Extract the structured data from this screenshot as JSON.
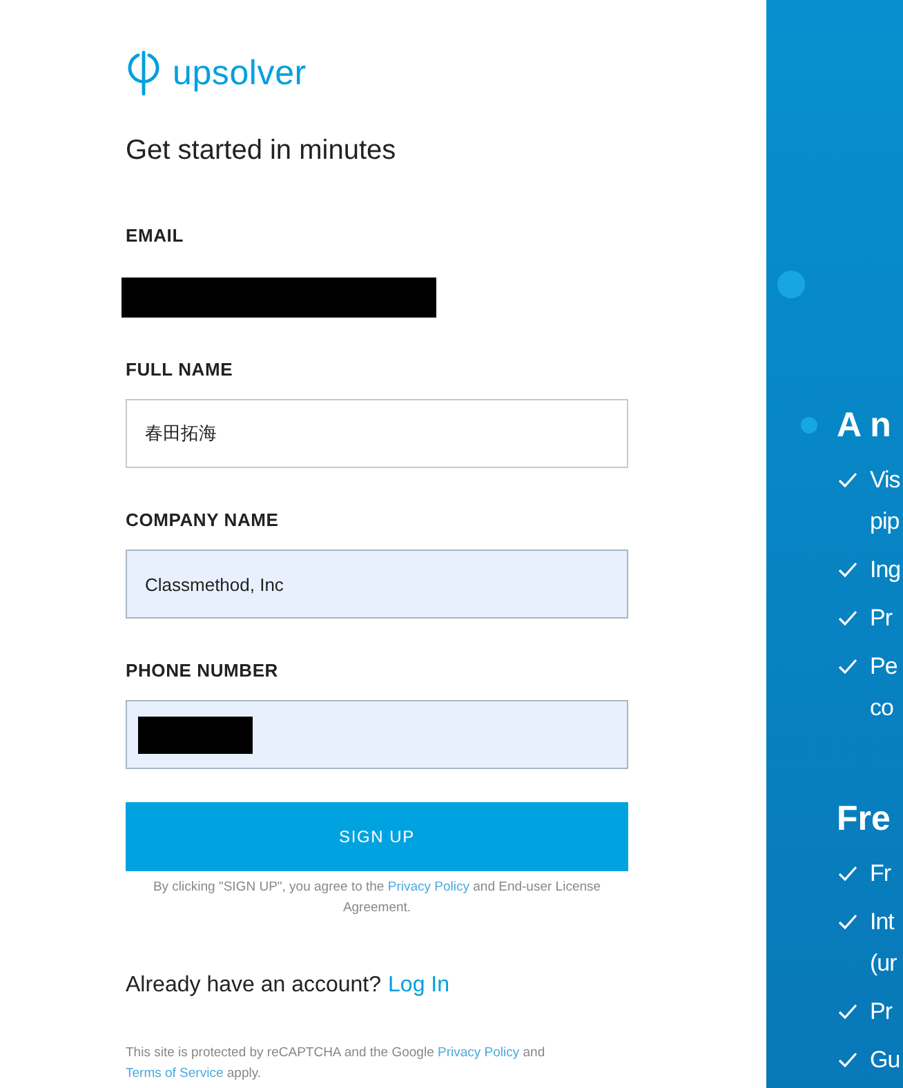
{
  "logo": {
    "text": "upsolver"
  },
  "heading": "Get started in minutes",
  "fields": [
    {
      "label": "EMAIL",
      "kind": "redacted",
      "autofilled": false
    },
    {
      "label": "FULL NAME",
      "kind": "text",
      "value": "春田拓海",
      "autofilled": false
    },
    {
      "label": "COMPANY NAME",
      "kind": "text",
      "value": "Classmethod, Inc",
      "autofilled": true
    },
    {
      "label": "PHONE NUMBER",
      "kind": "redacted-field",
      "autofilled": true
    }
  ],
  "submit": "SIGN UP",
  "agreement": {
    "before": "By clicking \"SIGN UP\", you agree to the ",
    "link": "Privacy Policy",
    "after": " and End-user License Agreement."
  },
  "login": {
    "question": "Already have an account?",
    "link": "Log In"
  },
  "recaptcha": {
    "before": "This site is protected by reCAPTCHA and the Google ",
    "link1": "Privacy Policy",
    "middle": " and ",
    "link2": "Terms of Service",
    "after": " apply."
  },
  "side_panel": {
    "sections": [
      {
        "heading": "A n",
        "bullet": true,
        "items": [
          [
            "Vis",
            "pip"
          ],
          [
            "Ing"
          ],
          [
            "Pr"
          ],
          [
            "Pe",
            "co"
          ]
        ]
      },
      {
        "heading": "Fre",
        "bullet": false,
        "items": [
          [
            "Fr"
          ],
          [
            "Int",
            "(ur"
          ],
          [
            "Pr"
          ],
          [
            "Gu"
          ]
        ]
      }
    ]
  }
}
